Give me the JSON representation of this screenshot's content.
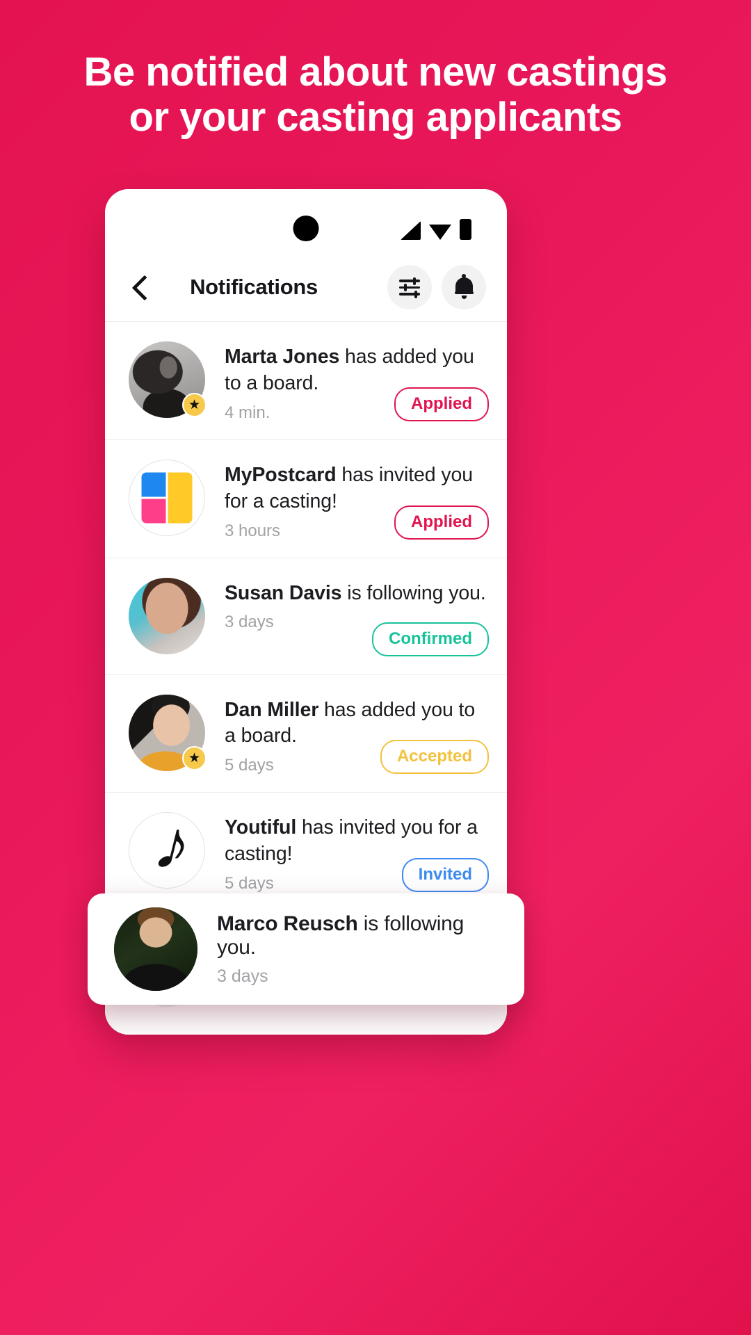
{
  "headline": {
    "line1": "Be notified about new castings",
    "line2": "or your casting applicants"
  },
  "colors": {
    "brand_pink": "#e4134f",
    "applied": "#e01550",
    "confirmed": "#17c39a",
    "accepted": "#f2c23d",
    "invited": "#3d8bf2",
    "star_badge": "#f7c94b"
  },
  "phone": {
    "statusbar": {
      "signal_icon": "signal-icon",
      "wifi_icon": "wifi-icon",
      "battery_icon": "battery-icon",
      "camera_icon": "camera-punchhole"
    },
    "navbar": {
      "back_icon": "chevron-left-icon",
      "title": "Notifications",
      "filter_icon": "sliders-filter-icon",
      "bell_icon": "bell-icon"
    },
    "notifications": [
      {
        "actor": "Marta Jones",
        "text": " has added you to a board.",
        "time": "4 min.",
        "badge": "Applied",
        "badge_type": "applied",
        "avatar": "photo-marta",
        "has_star": true
      },
      {
        "actor": "MyPostcard",
        "text": " has invited you for a casting!",
        "time": "3 hours",
        "badge": "Applied",
        "badge_type": "applied",
        "avatar": "logo-mypostcard",
        "has_star": false
      },
      {
        "actor": "Susan Davis",
        "text": " is following you.",
        "time": "3 days",
        "badge": "Confirmed",
        "badge_type": "confirmed",
        "avatar": "photo-susan",
        "has_star": false
      },
      {
        "actor": "Dan Miller",
        "text": " has added you to a board.",
        "time": "5 days",
        "badge": "Accepted",
        "badge_type": "accepted",
        "avatar": "photo-dan",
        "has_star": true
      },
      {
        "actor": "Youtiful",
        "text": " has invited you for a casting!",
        "time": "5 days",
        "badge": "Invited",
        "badge_type": "invited",
        "avatar": "logo-youtiful",
        "has_star": false
      }
    ]
  },
  "toast": {
    "actor": "Marco Reusch",
    "text": " is following you.",
    "time": "3 days",
    "avatar": "photo-marco"
  }
}
